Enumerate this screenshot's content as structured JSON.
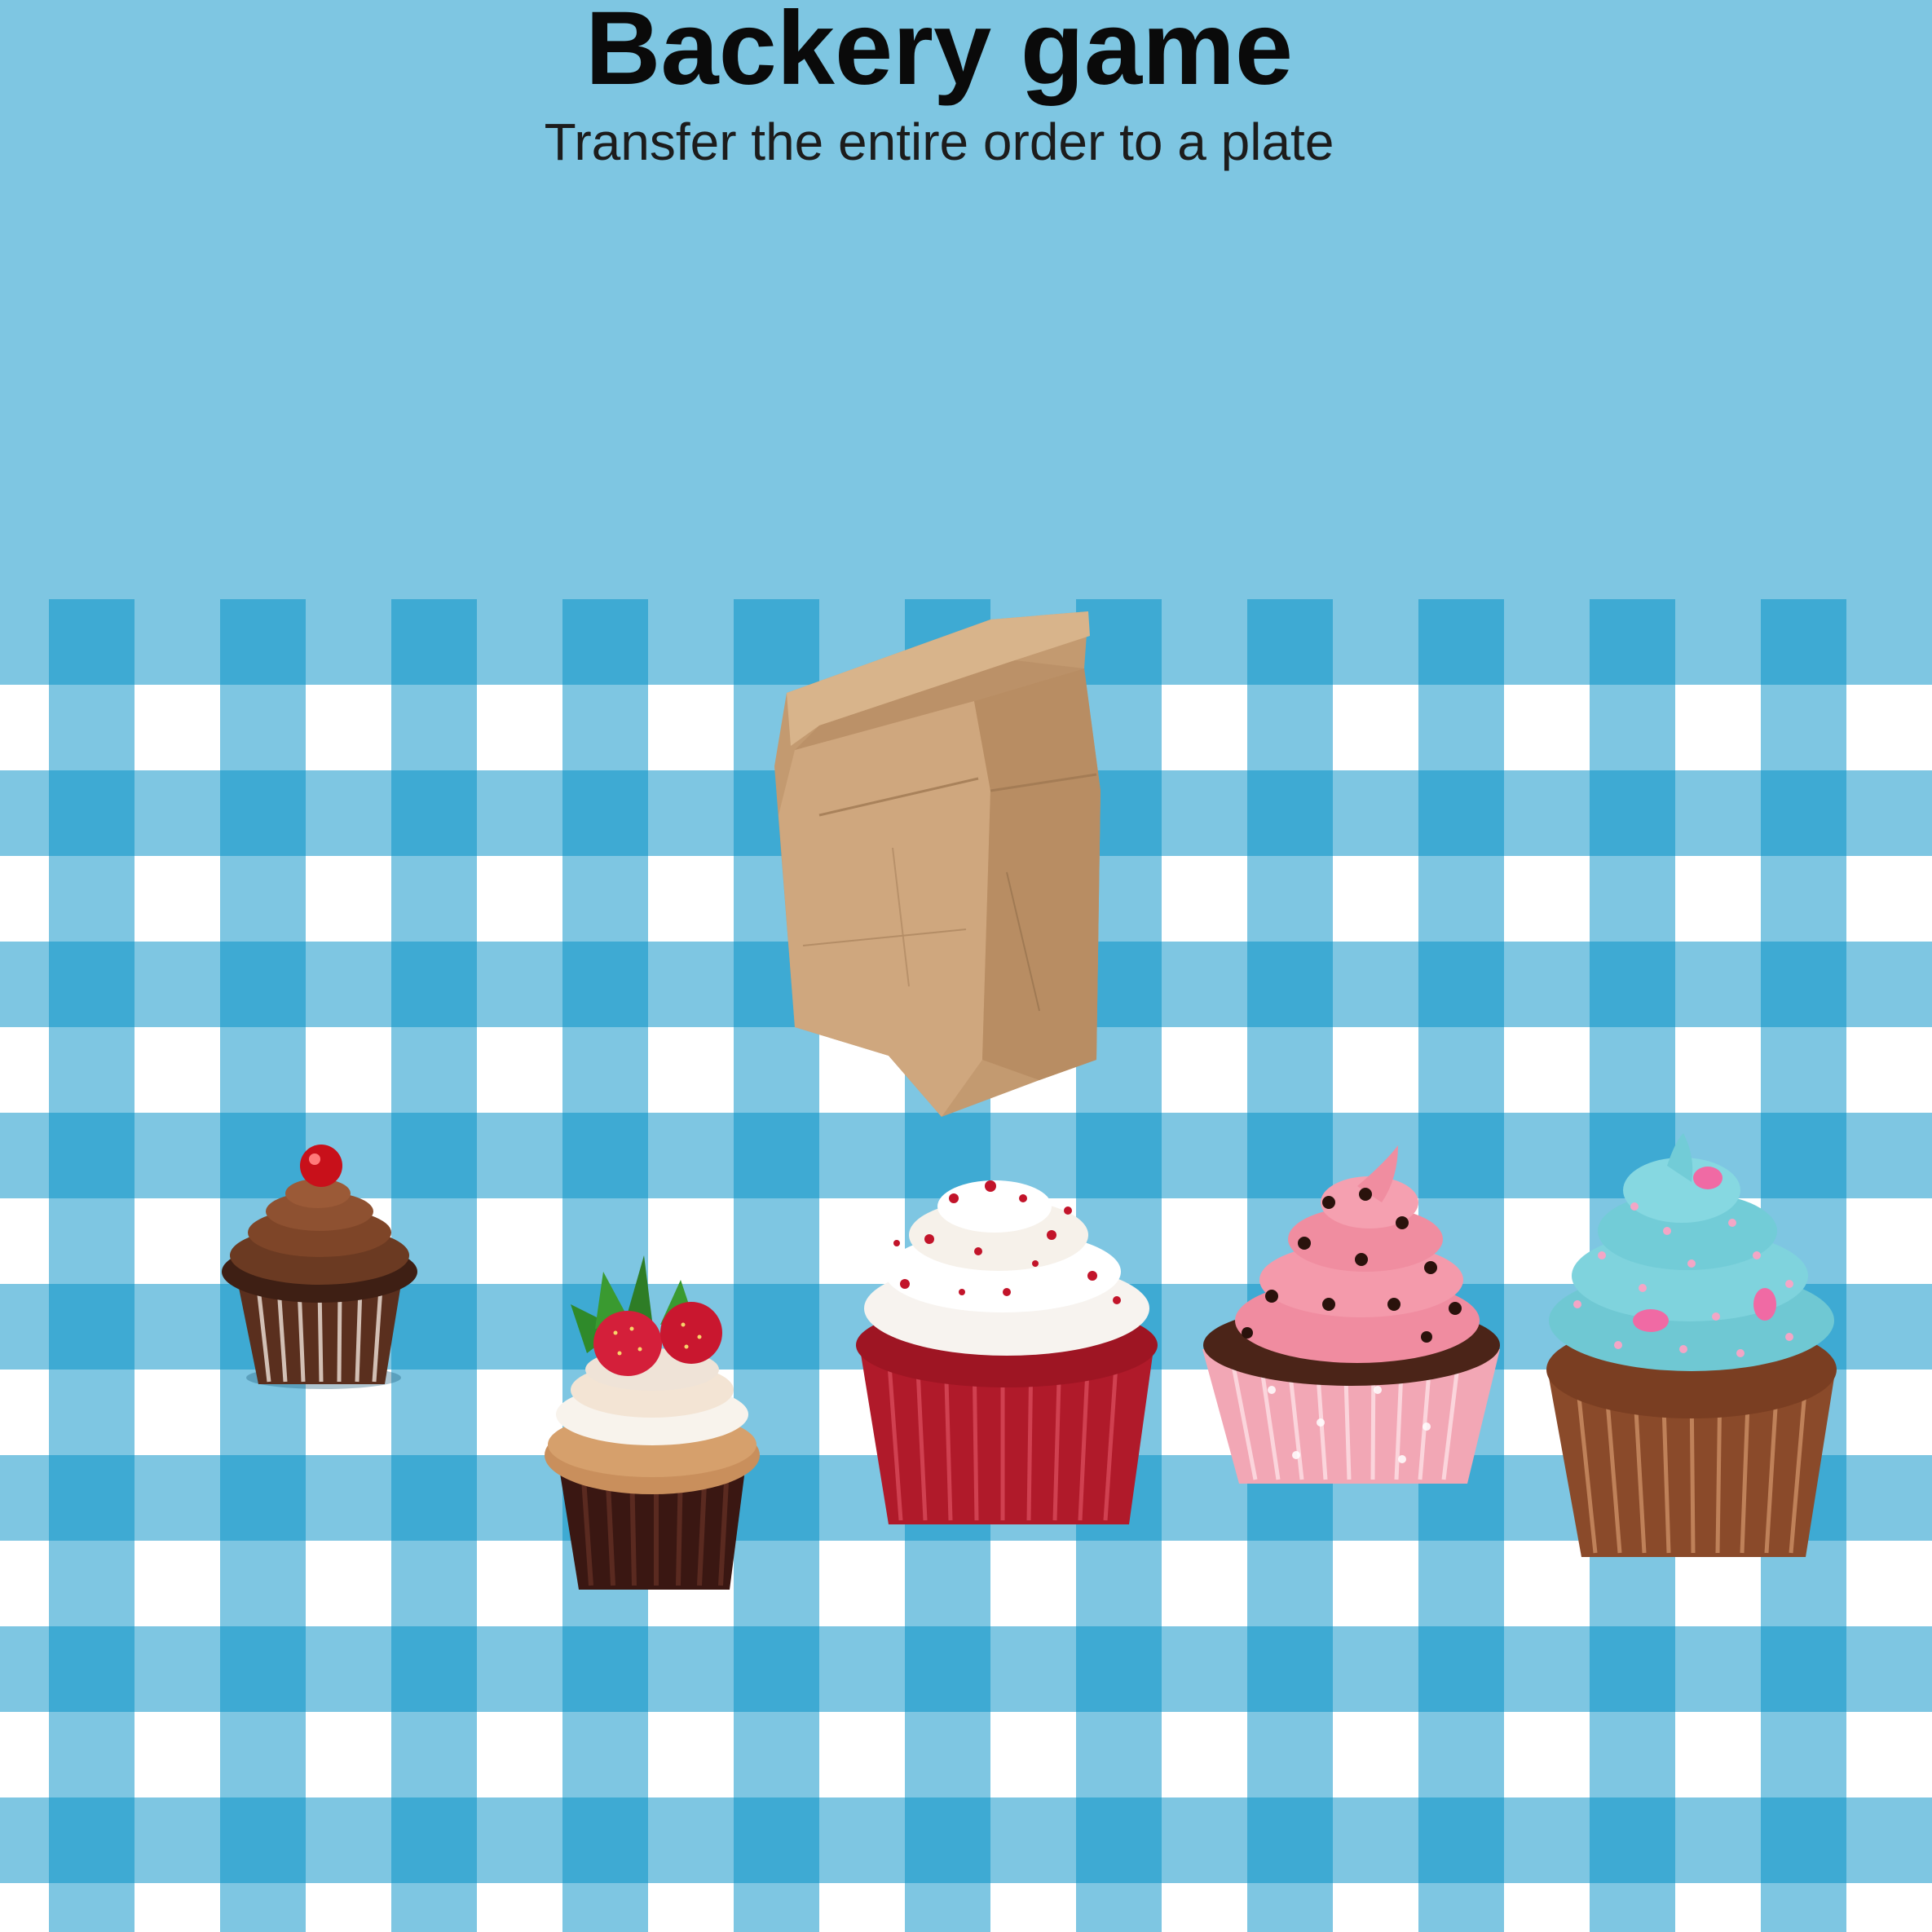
{
  "game": {
    "title": "Backery game",
    "instruction": "Transfer the entire order to a plate"
  },
  "colors": {
    "background": "#7ec6e2",
    "cloth_light": "#7ec6e2",
    "cloth_dark": "#3eaad3",
    "cloth_white": "#ffffff",
    "bag": "#c9a27a"
  },
  "items": [
    {
      "name": "paper-bag",
      "kind": "bag"
    },
    {
      "name": "chocolate-cherry-cupcake",
      "kind": "cupcake"
    },
    {
      "name": "strawberry-cupcake",
      "kind": "cupcake"
    },
    {
      "name": "red-velvet-cupcake",
      "kind": "cupcake"
    },
    {
      "name": "pink-frosting-cupcake",
      "kind": "cupcake"
    },
    {
      "name": "blue-frosting-cupcake",
      "kind": "cupcake"
    }
  ]
}
